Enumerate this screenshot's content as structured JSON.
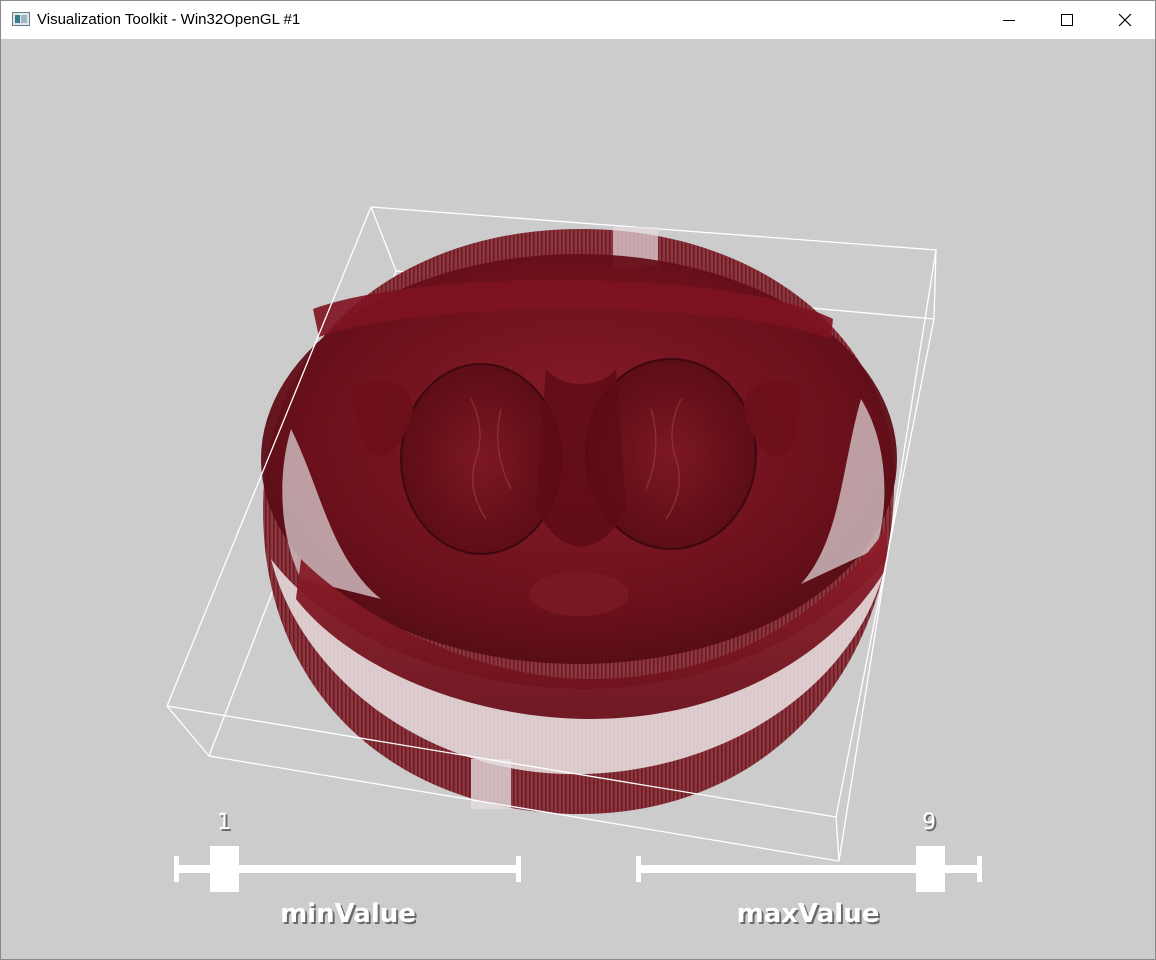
{
  "window": {
    "title": "Visualization Toolkit - Win32OpenGL #1",
    "icon": "vtk-app-icon",
    "controls": [
      "minimize-icon",
      "maximize-icon",
      "close-icon"
    ]
  },
  "viewport": {
    "background_color": "#cccccc",
    "volume_color": "#7a1420",
    "bbox_color": "#ffffff"
  },
  "sliders": {
    "min": {
      "label": "minValue",
      "value_text": "1",
      "value": 1,
      "range": [
        1,
        9
      ]
    },
    "max": {
      "label": "maxValue",
      "value_text": "9",
      "value": 9,
      "range": [
        1,
        9
      ]
    }
  }
}
